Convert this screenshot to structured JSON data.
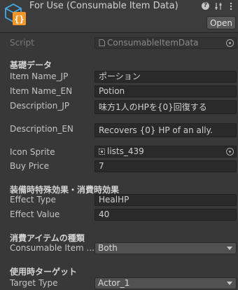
{
  "header": {
    "title": "For Use (Consumable Item Data)",
    "open_label": "Open",
    "icons": [
      "help-icon",
      "settings-icon",
      "menu-icon"
    ]
  },
  "script": {
    "label": "Script",
    "value": "ConsumableItemData"
  },
  "sections": {
    "basic": "基礎データ",
    "effects": "装備時特殊効果・消費時効果",
    "consumable_type": "消費アイテムの種類",
    "use_target": "使用時ターゲット"
  },
  "fields": {
    "item_name_jp": {
      "label": "Item Name_JP",
      "value": "ポーション"
    },
    "item_name_en": {
      "label": "Item Name_EN",
      "value": "Potion"
    },
    "description_jp": {
      "label": "Description_JP",
      "value": "味方1人のHPを{0}回復する"
    },
    "description_en": {
      "label": "Description_EN",
      "value": "Recovers {0} HP of an ally."
    },
    "icon_sprite": {
      "label": "Icon Sprite",
      "value": "lists_439"
    },
    "buy_price": {
      "label": "Buy Price",
      "value": "7"
    },
    "effect_type": {
      "label": "Effect Type",
      "value": "HealHP"
    },
    "effect_value": {
      "label": "Effect Value",
      "value": "40"
    },
    "consumable_item": {
      "label": "Consumable Item ...",
      "value": "Both"
    },
    "target_type": {
      "label": "Target Type",
      "value": "Actor_1"
    }
  },
  "colors": {
    "background": "#383838",
    "field_bg": "#2a2a2a",
    "dropdown_bg": "#515151",
    "icon_blue": "#46a8e6",
    "icon_orange": "#f0962a"
  }
}
